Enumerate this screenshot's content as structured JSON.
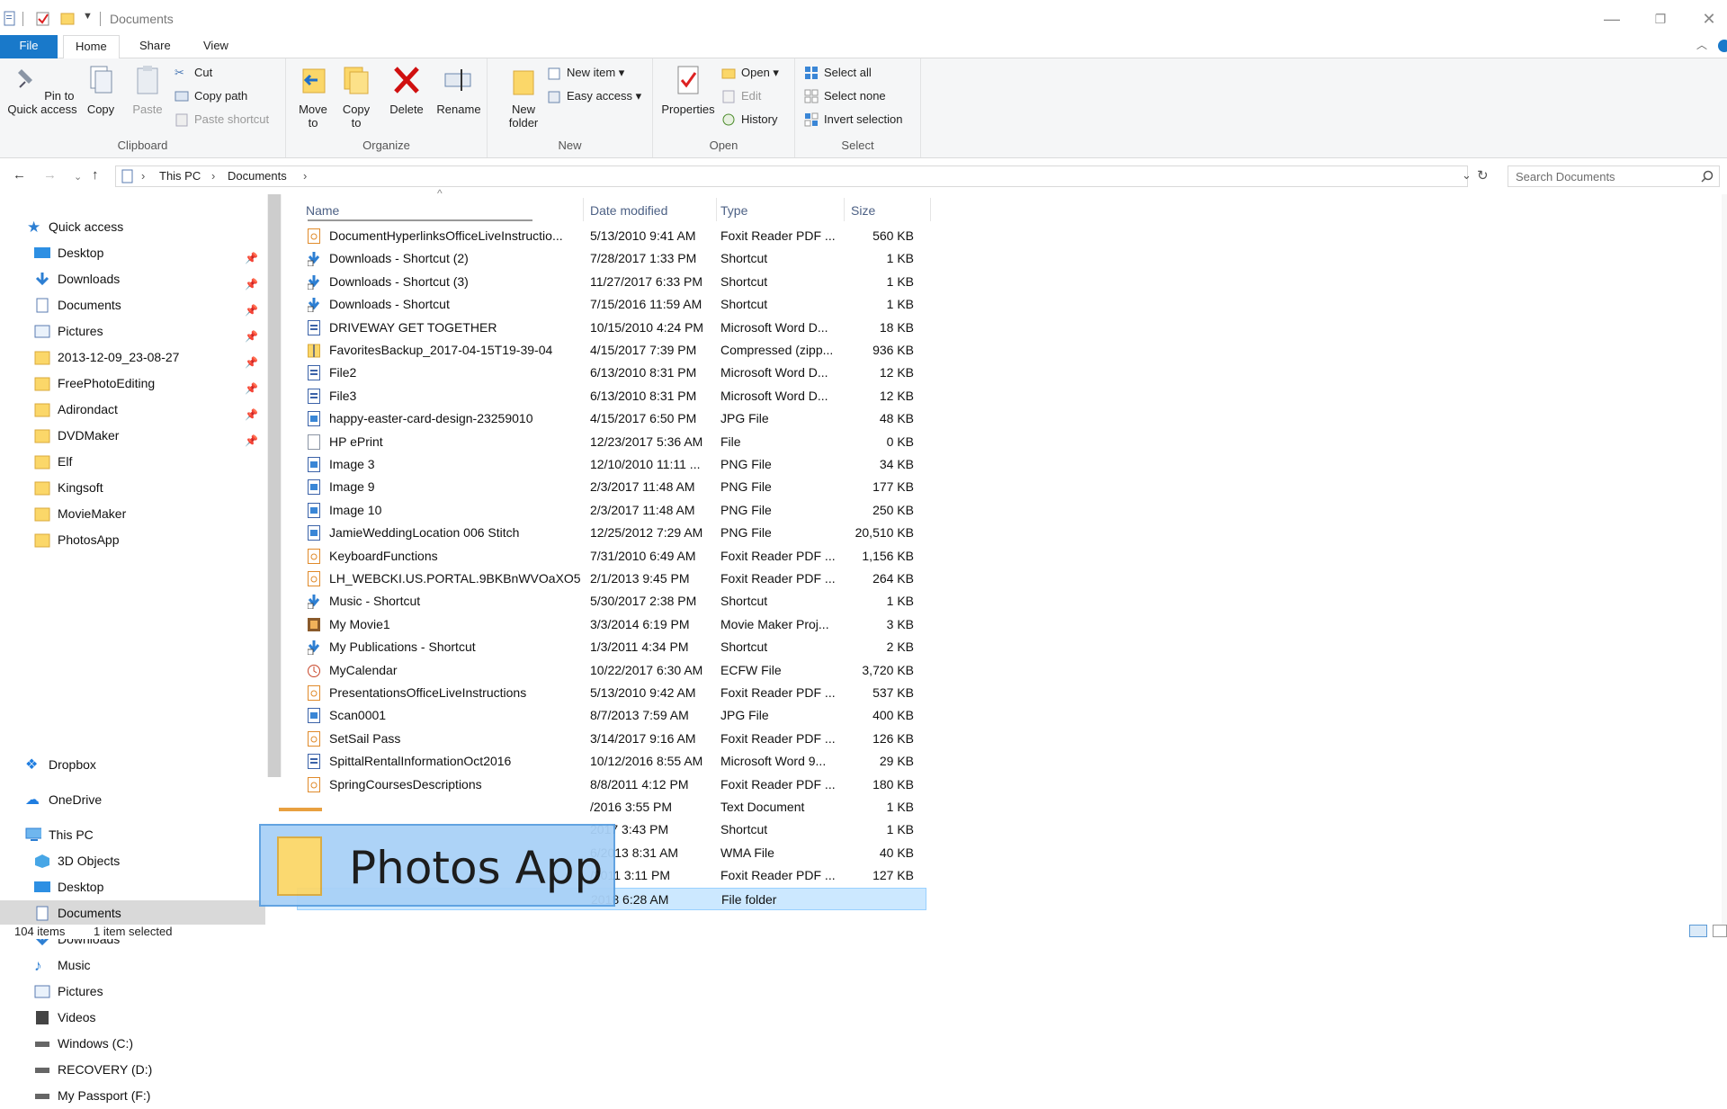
{
  "window": {
    "title": "Documents"
  },
  "titlebar_icons": [
    "document-icon",
    "checkmark-icon",
    "folder-icon",
    "dropdown-arrow-icon"
  ],
  "window_buttons": {
    "minimize": "—",
    "restore": "❐",
    "close": "✕"
  },
  "ribbon_tabs": {
    "file": "File",
    "home": "Home",
    "share": "Share",
    "view": "View"
  },
  "ribbon": {
    "clipboard": {
      "label": "Clipboard",
      "pin": "Pin to Quick access",
      "copy": "Copy",
      "paste": "Paste",
      "cut": "Cut",
      "copy_path": "Copy path",
      "paste_shortcut": "Paste shortcut"
    },
    "organize": {
      "label": "Organize",
      "move_to": "Move to",
      "copy_to": "Copy to",
      "delete": "Delete",
      "rename": "Rename"
    },
    "new": {
      "label": "New",
      "new_folder": "New folder",
      "new_item": "New item",
      "easy_access": "Easy access"
    },
    "open": {
      "label": "Open",
      "properties": "Properties",
      "open": "Open",
      "edit": "Edit",
      "history": "History"
    },
    "select": {
      "label": "Select",
      "select_all": "Select all",
      "select_none": "Select none",
      "invert": "Invert selection"
    }
  },
  "address": {
    "this_pc": "This PC",
    "documents": "Documents"
  },
  "search": {
    "placeholder": "Search Documents"
  },
  "sidebar": {
    "quick_access": "Quick access",
    "quick_items": [
      "Desktop",
      "Downloads",
      "Documents",
      "Pictures",
      "2013-12-09_23-08-27",
      "FreePhotoEditing",
      "Adirondact",
      "DVDMaker",
      "Elf",
      "Kingsoft",
      "MovieMaker",
      "PhotosApp"
    ],
    "dropbox": "Dropbox",
    "onedrive": "OneDrive",
    "this_pc": "This PC",
    "pc_items": [
      "3D Objects",
      "Desktop",
      "Documents",
      "Downloads",
      "Music",
      "Pictures",
      "Videos",
      "Windows (C:)",
      "RECOVERY (D:)",
      "My Passport (F:)"
    ]
  },
  "columns": {
    "name": "Name",
    "date": "Date modified",
    "type": "Type",
    "size": "Size"
  },
  "files": [
    {
      "name": "DocumentHyperlinksOfficeLiveInstructio...",
      "date": "5/13/2010 9:41 AM",
      "type": "Foxit Reader PDF ...",
      "size": "560 KB"
    },
    {
      "name": "Downloads - Shortcut (2)",
      "date": "7/28/2017 1:33 PM",
      "type": "Shortcut",
      "size": "1 KB"
    },
    {
      "name": "Downloads - Shortcut (3)",
      "date": "11/27/2017 6:33 PM",
      "type": "Shortcut",
      "size": "1 KB"
    },
    {
      "name": "Downloads - Shortcut",
      "date": "7/15/2016 11:59 AM",
      "type": "Shortcut",
      "size": "1 KB"
    },
    {
      "name": "DRIVEWAY GET TOGETHER",
      "date": "10/15/2010 4:24 PM",
      "type": "Microsoft Word D...",
      "size": "18 KB"
    },
    {
      "name": "FavoritesBackup_2017-04-15T19-39-04",
      "date": "4/15/2017 7:39 PM",
      "type": "Compressed (zipp...",
      "size": "936 KB"
    },
    {
      "name": "File2",
      "date": "6/13/2010 8:31 PM",
      "type": "Microsoft Word D...",
      "size": "12 KB"
    },
    {
      "name": "File3",
      "date": "6/13/2010 8:31 PM",
      "type": "Microsoft Word D...",
      "size": "12 KB"
    },
    {
      "name": "happy-easter-card-design-23259010",
      "date": "4/15/2017 6:50 PM",
      "type": "JPG File",
      "size": "48 KB"
    },
    {
      "name": "HP ePrint",
      "date": "12/23/2017 5:36 AM",
      "type": "File",
      "size": "0 KB"
    },
    {
      "name": "Image 3",
      "date": "12/10/2010 11:11 ...",
      "type": "PNG File",
      "size": "34 KB"
    },
    {
      "name": "Image 9",
      "date": "2/3/2017 11:48 AM",
      "type": "PNG File",
      "size": "177 KB"
    },
    {
      "name": "Image 10",
      "date": "2/3/2017 11:48 AM",
      "type": "PNG File",
      "size": "250 KB"
    },
    {
      "name": "JamieWeddingLocation 006 Stitch",
      "date": "12/25/2012 7:29 AM",
      "type": "PNG File",
      "size": "20,510 KB"
    },
    {
      "name": "KeyboardFunctions",
      "date": "7/31/2010 6:49 AM",
      "type": "Foxit Reader PDF ...",
      "size": "1,156 KB"
    },
    {
      "name": "LH_WEBCKI.US.PORTAL.9BKBnWVOaXO5...",
      "date": "2/1/2013 9:45 PM",
      "type": "Foxit Reader PDF ...",
      "size": "264 KB"
    },
    {
      "name": "Music - Shortcut",
      "date": "5/30/2017 2:38 PM",
      "type": "Shortcut",
      "size": "1 KB"
    },
    {
      "name": "My Movie1",
      "date": "3/3/2014 6:19 PM",
      "type": "Movie Maker Proj...",
      "size": "3 KB"
    },
    {
      "name": "My Publications - Shortcut",
      "date": "1/3/2011 4:34 PM",
      "type": "Shortcut",
      "size": "2 KB"
    },
    {
      "name": "MyCalendar",
      "date": "10/22/2017 6:30 AM",
      "type": "ECFW File",
      "size": "3,720 KB"
    },
    {
      "name": "PresentationsOfficeLiveInstructions",
      "date": "5/13/2010 9:42 AM",
      "type": "Foxit Reader PDF ...",
      "size": "537 KB"
    },
    {
      "name": "Scan0001",
      "date": "8/7/2013 7:59 AM",
      "type": "JPG File",
      "size": "400 KB"
    },
    {
      "name": "SetSail Pass",
      "date": "3/14/2017 9:16 AM",
      "type": "Foxit Reader PDF ...",
      "size": "126 KB"
    },
    {
      "name": "SpittalRentalInformationOct2016",
      "date": "10/12/2016 8:55 AM",
      "type": "Microsoft Word 9...",
      "size": "29 KB"
    },
    {
      "name": "SpringCoursesDescriptions",
      "date": "8/8/2011 4:12 PM",
      "type": "Foxit Reader PDF ...",
      "size": "180 KB"
    },
    {
      "name": "",
      "date": "/2016 3:55 PM",
      "type": "Text Document",
      "size": "1 KB"
    },
    {
      "name": "",
      "date": "2017 3:43 PM",
      "type": "Shortcut",
      "size": "1 KB"
    },
    {
      "name": "",
      "date": "6/2013 8:31 AM",
      "type": "WMA File",
      "size": "40 KB"
    },
    {
      "name": "",
      "date": "/2011 3:11 PM",
      "type": "Foxit Reader PDF ...",
      "size": "127 KB"
    },
    {
      "name": "",
      "date": "2018 6:28 AM",
      "type": "File folder",
      "size": ""
    }
  ],
  "drag_ghost": {
    "label": "Photos App"
  },
  "status": {
    "count": "104 items",
    "selected": "1 item selected"
  }
}
